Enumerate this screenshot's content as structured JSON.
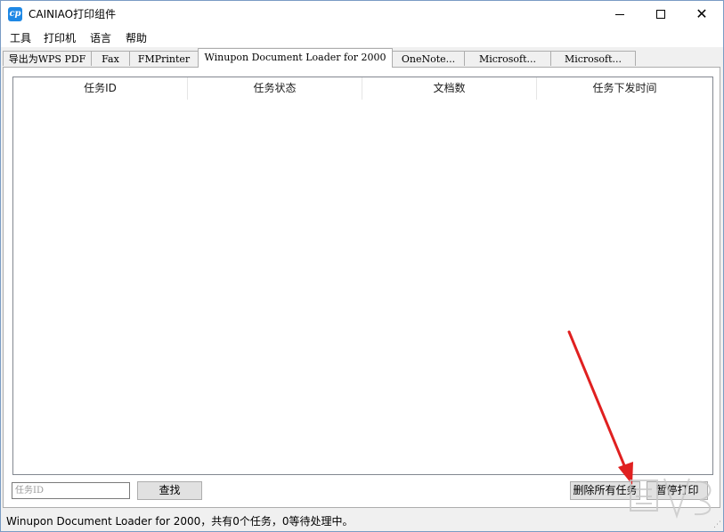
{
  "window": {
    "title": "CAINIAO打印组件",
    "icon_label": "cp",
    "minimize_symbol": "",
    "close_symbol": "✕"
  },
  "menu": {
    "items": [
      "工具",
      "打印机",
      "语言",
      "帮助"
    ]
  },
  "tabs": [
    {
      "label": "导出为WPS PDF",
      "active": false
    },
    {
      "label": "Fax",
      "active": false
    },
    {
      "label": "FMPrinter",
      "active": false
    },
    {
      "label": "Winupon Document Loader for 2000",
      "active": true
    },
    {
      "label": "OneNote...",
      "active": false
    },
    {
      "label": "Microsoft...",
      "active": false
    },
    {
      "label": "Microsoft...",
      "active": false
    }
  ],
  "job_list": {
    "columns": [
      "任务ID",
      "任务状态",
      "文档数",
      "任务下发时间"
    ],
    "rows": []
  },
  "controls": {
    "search_placeholder": "任务ID",
    "search_value": "",
    "search_button": "查找",
    "delete_all_button": "删除所有任务",
    "pause_button": "暂停打印"
  },
  "status": {
    "text": "Winupon Document Loader for 2000，共有0个任务，0等待处理中。"
  },
  "colors": {
    "annotation_arrow": "#e02020",
    "accent": "#1e88e5"
  }
}
